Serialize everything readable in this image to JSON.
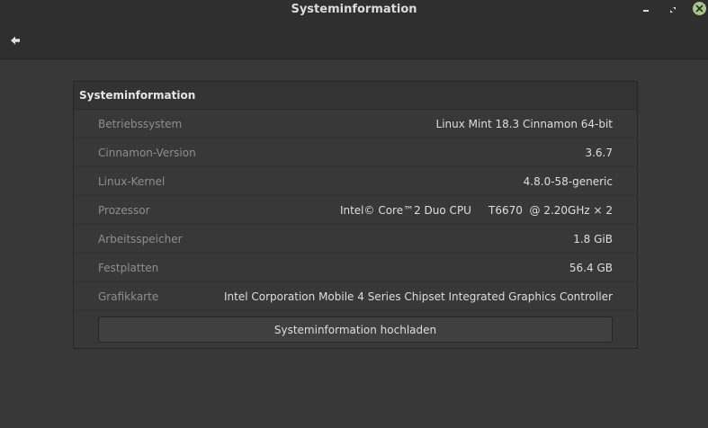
{
  "window": {
    "title": "Systeminformation",
    "controls": [
      "minimize-icon",
      "maximize-icon",
      "close-icon"
    ]
  },
  "toolbar": {
    "back_icon": "back-arrow-icon"
  },
  "panel": {
    "title": "Systeminformation",
    "rows": [
      {
        "label": "Betriebssystem",
        "value": "Linux Mint 18.3 Cinnamon 64-bit"
      },
      {
        "label": "Cinnamon-Version",
        "value": "3.6.7"
      },
      {
        "label": "Linux-Kernel",
        "value": "4.8.0-58-generic"
      },
      {
        "label": "Prozessor",
        "value": "Intel© Core™2 Duo CPU     T6670  @ 2.20GHz × 2"
      },
      {
        "label": "Arbeitsspeicher",
        "value": "1.8 GiB"
      },
      {
        "label": "Festplatten",
        "value": "56.4 GB"
      },
      {
        "label": "Grafikkarte",
        "value": "Intel Corporation Mobile 4 Series Chipset Integrated Graphics Controller"
      }
    ],
    "upload_label": "Systeminformation hochladen"
  },
  "colors": {
    "titlebar": "#2f2f2f",
    "background": "#383838",
    "close_button": "#a9c885"
  }
}
